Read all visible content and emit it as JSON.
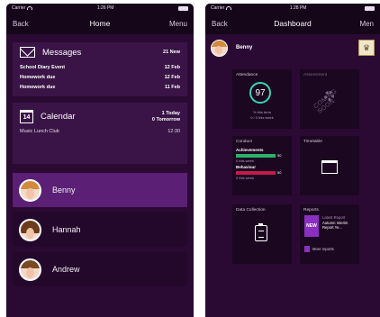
{
  "screen1": {
    "status": {
      "carrier": "Carrier",
      "time": "1:26 PM"
    },
    "nav": {
      "back": "Back",
      "title": "Home",
      "menu": "Menu"
    },
    "messages": {
      "title": "Messages",
      "count": "21 New",
      "items": [
        {
          "label": "School Diary Event",
          "date": "12 Feb"
        },
        {
          "label": "Homework due",
          "date": "12 Feb"
        },
        {
          "label": "Homework due",
          "date": "11 Feb"
        }
      ]
    },
    "calendar": {
      "icon_day": "14",
      "title": "Calendar",
      "today": "1 Today",
      "tomorrow": "0 Tomorrow",
      "event": {
        "label": "Music Lunch Club",
        "time": "12:30"
      }
    },
    "children": [
      {
        "name": "Benny",
        "selected": true,
        "hair": "#d28a3e"
      },
      {
        "name": "Hannah",
        "selected": false,
        "hair": "#6b3b1c"
      },
      {
        "name": "Andrew",
        "selected": false,
        "hair": "#7a4a24"
      }
    ]
  },
  "screen2": {
    "status": {
      "carrier": "Carrier",
      "time": "1:28 PM"
    },
    "nav": {
      "back": "Back",
      "title": "Dashboard",
      "menu": "Men"
    },
    "user": {
      "name": "Benny"
    },
    "tiles": {
      "attendance": {
        "title": "Attendance",
        "value": "97",
        "line1": "% this term",
        "line2": "0 / 0 this week"
      },
      "assessment": {
        "title": "Assessment",
        "overlay": "COMING SOON"
      },
      "conduct": {
        "title": "Conduct",
        "achievements_label": "Achievements",
        "achievements_value": "50",
        "achievements_week": "0 this week",
        "behaviour_label": "Behaviour",
        "behaviour_value": "50",
        "behaviour_week": "0 this week"
      },
      "timetable": {
        "title": "Timetable"
      },
      "data_collection": {
        "title": "Data Collection"
      },
      "reports": {
        "title": "Reports",
        "doc_label": "NEW",
        "latest": "Latest Report",
        "report_name": "Autumn Interim Report Ye...",
        "more": "More reports"
      }
    },
    "colors": {
      "accent": "#3bd5b0",
      "achievements": "#2eb06a",
      "behaviour": "#c41a4a",
      "selected_row": "#5b1f76"
    }
  }
}
